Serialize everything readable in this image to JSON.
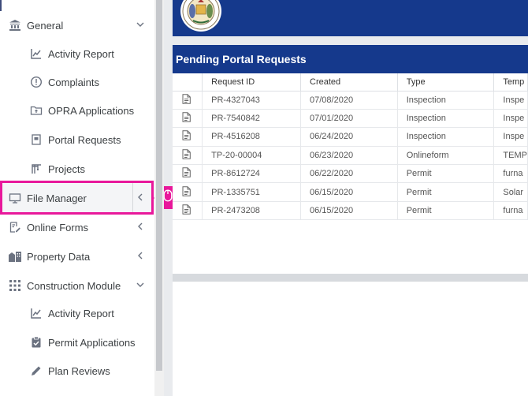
{
  "sidebar": {
    "items": [
      {
        "label": "General",
        "icon": "bank-icon",
        "expanded": true
      },
      {
        "label": "Activity Report",
        "icon": "chart-line-icon"
      },
      {
        "label": "Complaints",
        "icon": "alert-circle-icon"
      },
      {
        "label": "OPRA Applications",
        "icon": "folder-arrow-icon"
      },
      {
        "label": "Portal Requests",
        "icon": "page-icon"
      },
      {
        "label": "Projects",
        "icon": "crane-icon"
      },
      {
        "label": "File Manager",
        "icon": "monitor-icon",
        "expanded": false
      },
      {
        "label": "Online Forms",
        "icon": "form-edit-icon",
        "expanded": false
      },
      {
        "label": "Property Data",
        "icon": "buildings-icon",
        "expanded": false
      },
      {
        "label": "Construction Module",
        "icon": "grid-dots-icon",
        "expanded": true
      },
      {
        "label": "Activity Report",
        "icon": "chart-line-icon"
      },
      {
        "label": "Permit Applications",
        "icon": "clipboard-check-icon"
      },
      {
        "label": "Plan Reviews",
        "icon": "pen-icon"
      }
    ]
  },
  "highlight_color": "#e8189b",
  "header_color": "#15398c",
  "panel": {
    "title": "Pending Portal Requests",
    "columns": [
      "",
      "Request ID",
      "Created",
      "Type",
      "Temp"
    ],
    "rows": [
      [
        "PR-4327043",
        "07/08/2020",
        "Inspection",
        "Inspe"
      ],
      [
        "PR-7540842",
        "07/01/2020",
        "Inspection",
        "Inspe"
      ],
      [
        "PR-4516208",
        "06/24/2020",
        "Inspection",
        "Inspe"
      ],
      [
        "TP-20-00004",
        "06/23/2020",
        "Onlineform",
        "TEMP"
      ],
      [
        "PR-8612724",
        "06/22/2020",
        "Permit",
        "furna"
      ],
      [
        "PR-1335751",
        "06/15/2020",
        "Permit",
        "Solar"
      ],
      [
        "PR-2473208",
        "06/15/2020",
        "Permit",
        "furna"
      ]
    ]
  }
}
